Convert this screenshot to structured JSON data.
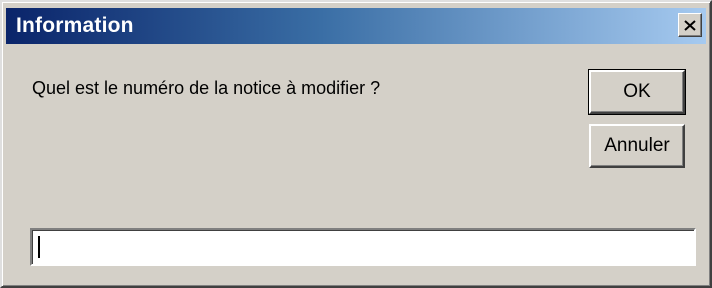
{
  "dialog": {
    "title": "Information",
    "prompt": "Quel est le numéro de la notice à modifier ?",
    "input_value": "",
    "input_placeholder": "",
    "buttons": {
      "ok_label": "OK",
      "cancel_label": "Annuler"
    },
    "icons": {
      "close": "close-icon"
    },
    "colors": {
      "titlebar_start": "#0a246a",
      "titlebar_end": "#a6caf0",
      "face": "#d4d0c8"
    }
  }
}
